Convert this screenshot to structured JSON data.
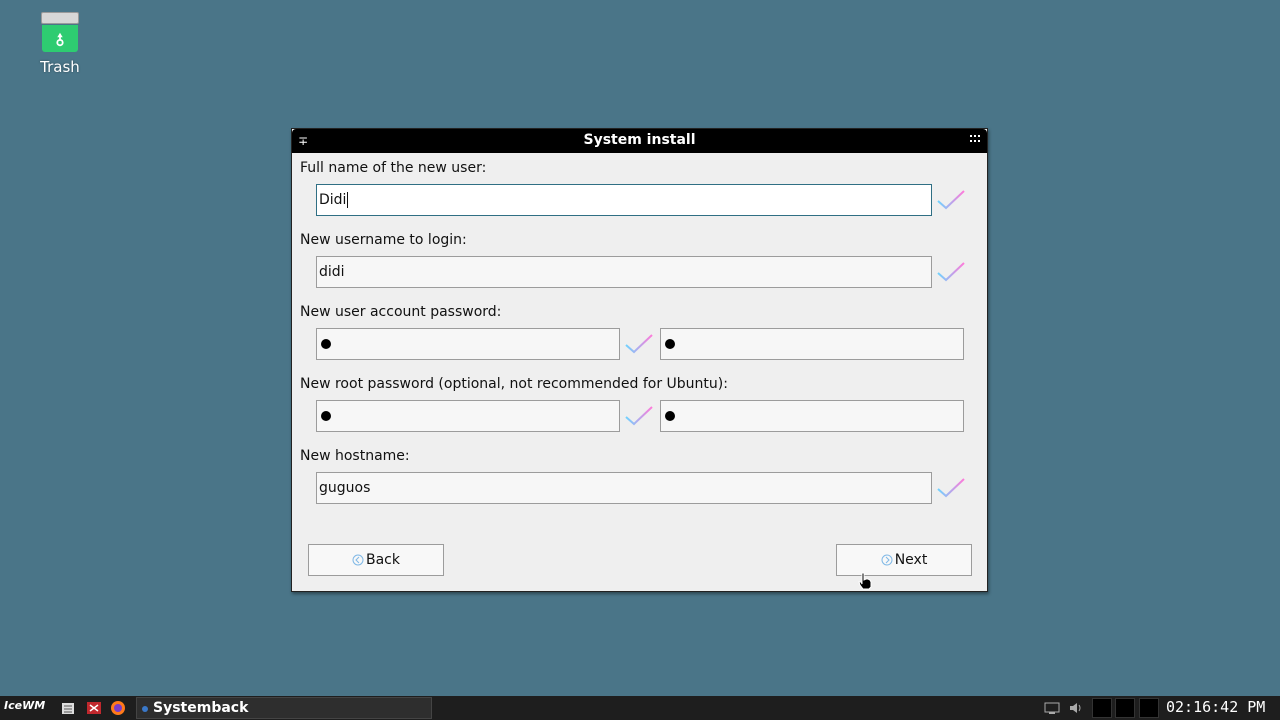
{
  "desktop": {
    "trash_label": "Trash"
  },
  "window": {
    "title": "System install",
    "full_name": {
      "label": "Full name of the new user:",
      "value": "Didi"
    },
    "username": {
      "label": "New username to login:",
      "value": "didi"
    },
    "user_password": {
      "label": "New user account password:",
      "value": "●",
      "confirm_value": "●"
    },
    "root_password": {
      "label": "New root password (optional, not recommended for Ubuntu):",
      "value": "●",
      "confirm_value": "●"
    },
    "hostname": {
      "label": "New hostname:",
      "value": "guguos"
    },
    "back_label": "Back",
    "next_label": "Next"
  },
  "taskbar": {
    "start_label": "IceWM",
    "task_label": "Systemback",
    "clock": "02:16:42 PM"
  },
  "colors": {
    "desktop_bg": "#4a7588",
    "check_gradient_start": "#6fd3ff",
    "check_gradient_end": "#ff7ad9",
    "focus_border": "#2f6f84"
  },
  "icons": {
    "trash": "trash-icon",
    "back": "back-arrow-icon",
    "next": "next-arrow-icon",
    "valid": "checkmark-icon"
  }
}
